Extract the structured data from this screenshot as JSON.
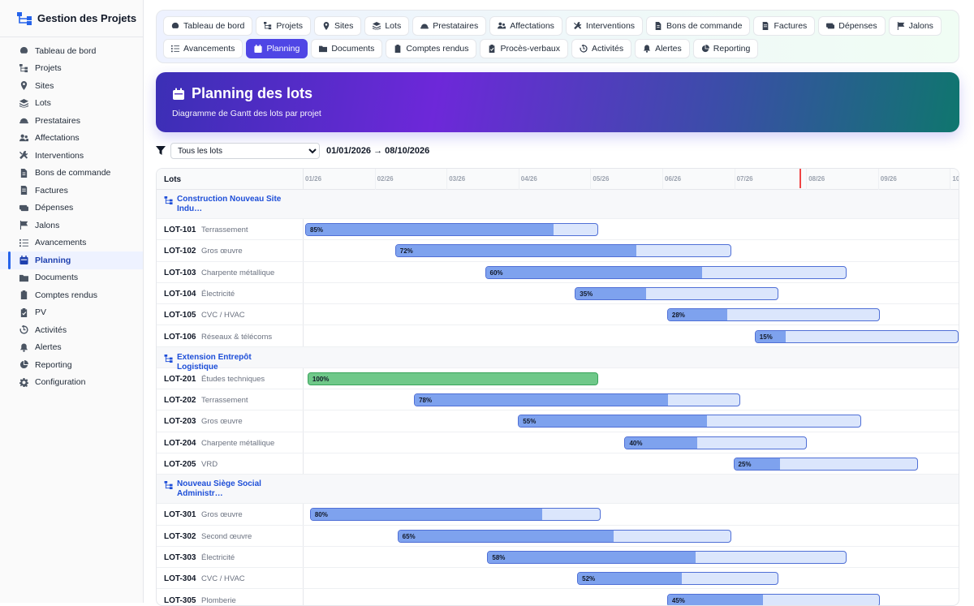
{
  "app": {
    "title": "Gestion des Projets"
  },
  "sidebar": {
    "items": [
      {
        "label": "Tableau de bord",
        "icon": "gauge-icon"
      },
      {
        "label": "Projets",
        "icon": "sitemap-icon"
      },
      {
        "label": "Sites",
        "icon": "location-pin-icon"
      },
      {
        "label": "Lots",
        "icon": "layers-icon"
      },
      {
        "label": "Prestataires",
        "icon": "helmet-icon"
      },
      {
        "label": "Affectations",
        "icon": "users-icon"
      },
      {
        "label": "Interventions",
        "icon": "tools-icon"
      },
      {
        "label": "Bons de commande",
        "icon": "file-icon"
      },
      {
        "label": "Factures",
        "icon": "invoice-icon"
      },
      {
        "label": "Dépenses",
        "icon": "money-icon"
      },
      {
        "label": "Jalons",
        "icon": "flag-icon"
      },
      {
        "label": "Avancements",
        "icon": "list-check-icon"
      },
      {
        "label": "Planning",
        "icon": "calendar-icon",
        "active": true
      },
      {
        "label": "Documents",
        "icon": "folder-icon"
      },
      {
        "label": "Comptes rendus",
        "icon": "clipboard-icon"
      },
      {
        "label": "PV",
        "icon": "clipboard-check-icon"
      },
      {
        "label": "Activités",
        "icon": "history-icon"
      },
      {
        "label": "Alertes",
        "icon": "bell-icon"
      },
      {
        "label": "Reporting",
        "icon": "chart-pie-icon"
      },
      {
        "label": "Configuration",
        "icon": "gear-icon"
      }
    ]
  },
  "tabs": [
    {
      "label": "Tableau de bord",
      "icon": "gauge-icon"
    },
    {
      "label": "Projets",
      "icon": "sitemap-icon"
    },
    {
      "label": "Sites",
      "icon": "location-pin-icon"
    },
    {
      "label": "Lots",
      "icon": "layers-icon"
    },
    {
      "label": "Prestataires",
      "icon": "helmet-icon"
    },
    {
      "label": "Affectations",
      "icon": "users-icon"
    },
    {
      "label": "Interventions",
      "icon": "tools-icon"
    },
    {
      "label": "Bons de commande",
      "icon": "file-icon"
    },
    {
      "label": "Factures",
      "icon": "invoice-icon"
    },
    {
      "label": "Dépenses",
      "icon": "money-icon"
    },
    {
      "label": "Jalons",
      "icon": "flag-icon"
    },
    {
      "label": "Avancements",
      "icon": "list-check-icon"
    },
    {
      "label": "Planning",
      "icon": "calendar-icon",
      "active": true
    },
    {
      "label": "Documents",
      "icon": "folder-icon"
    },
    {
      "label": "Comptes rendus",
      "icon": "clipboard-icon"
    },
    {
      "label": "Procès-verbaux",
      "icon": "clipboard-check-icon"
    },
    {
      "label": "Activités",
      "icon": "history-icon"
    },
    {
      "label": "Alertes",
      "icon": "bell-icon"
    },
    {
      "label": "Reporting",
      "icon": "chart-pie-icon"
    }
  ],
  "hero": {
    "title": "Planning des lots",
    "subtitle": "Diagramme de Gantt des lots par projet"
  },
  "filter": {
    "selected": "Tous les lots",
    "range": "01/01/2026 → 08/10/2026"
  },
  "gantt": {
    "column_header": "Lots",
    "months": [
      "01/26",
      "02/26",
      "03/26",
      "04/26",
      "05/26",
      "06/26",
      "07/26",
      "08/26",
      "09/26",
      "10/26"
    ],
    "today": "2026-08-01",
    "colors": {
      "bar_fill": "#7ea2ee",
      "bar_bg": "#dbe6fc",
      "bar_done": "#6fc889",
      "today_line": "#ef4444"
    },
    "projects": [
      {
        "name": "Construction Nouveau Site Indu…",
        "lots": [
          {
            "code": "LOT-101",
            "name": "Terrassement",
            "start": "2026-01-01",
            "end": "2026-05-05",
            "progress": 85
          },
          {
            "code": "LOT-102",
            "name": "Gros œuvre",
            "start": "2026-02-08",
            "end": "2026-06-30",
            "progress": 72
          },
          {
            "code": "LOT-103",
            "name": "Charpente métallique",
            "start": "2026-03-18",
            "end": "2026-08-18",
            "progress": 60
          },
          {
            "code": "LOT-104",
            "name": "Électricité",
            "start": "2026-04-25",
            "end": "2026-07-20",
            "progress": 35
          },
          {
            "code": "LOT-105",
            "name": "CVC / HVAC",
            "start": "2026-06-03",
            "end": "2026-09-01",
            "progress": 28
          },
          {
            "code": "LOT-106",
            "name": "Réseaux & télécoms",
            "start": "2026-07-10",
            "end": "2026-10-08",
            "progress": 15
          }
        ]
      },
      {
        "name": "Extension Entrepôt Logistique",
        "lots": [
          {
            "code": "LOT-201",
            "name": "Études techniques",
            "start": "2026-01-02",
            "end": "2026-05-05",
            "progress": 100
          },
          {
            "code": "LOT-202",
            "name": "Terrassement",
            "start": "2026-02-16",
            "end": "2026-07-04",
            "progress": 78
          },
          {
            "code": "LOT-203",
            "name": "Gros œuvre",
            "start": "2026-04-01",
            "end": "2026-08-24",
            "progress": 55
          },
          {
            "code": "LOT-204",
            "name": "Charpente métallique",
            "start": "2026-05-16",
            "end": "2026-07-32",
            "progress": 40
          },
          {
            "code": "LOT-205",
            "name": "VRD",
            "start": "2026-07-01",
            "end": "2026-09-17",
            "progress": 25
          }
        ]
      },
      {
        "name": "Nouveau Siège Social Administr…",
        "lots": [
          {
            "code": "LOT-301",
            "name": "Gros œuvre",
            "start": "2026-01-03",
            "end": "2026-05-06",
            "progress": 80
          },
          {
            "code": "LOT-302",
            "name": "Second œuvre",
            "start": "2026-02-09",
            "end": "2026-06-30",
            "progress": 65
          },
          {
            "code": "LOT-303",
            "name": "Électricité",
            "start": "2026-03-19",
            "end": "2026-08-18",
            "progress": 58
          },
          {
            "code": "LOT-304",
            "name": "CVC / HVAC",
            "start": "2026-04-26",
            "end": "2026-07-20",
            "progress": 52
          },
          {
            "code": "LOT-305",
            "name": "Plomberie",
            "start": "2026-06-03",
            "end": "2026-09-01",
            "progress": 45
          }
        ]
      }
    ]
  }
}
